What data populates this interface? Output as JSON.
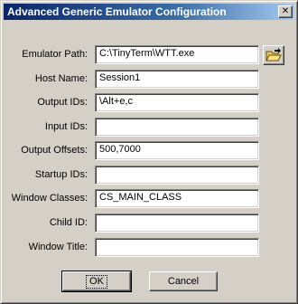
{
  "window": {
    "title": "Advanced Generic Emulator Configuration",
    "close_glyph": "✕"
  },
  "fields": [
    {
      "label": "Emulator Path:",
      "value": "C:\\TinyTerm\\WTT.exe"
    },
    {
      "label": "Host Name:",
      "value": "Session1"
    },
    {
      "label": "Output IDs:",
      "value": "\\Alt+e,c"
    },
    {
      "label": "Input IDs:",
      "value": ""
    },
    {
      "label": "Output Offsets:",
      "value": "500,7000"
    },
    {
      "label": "Startup IDs:",
      "value": ""
    },
    {
      "label": "Window Classes:",
      "value": "CS_MAIN_CLASS"
    },
    {
      "label": "Child ID:",
      "value": ""
    },
    {
      "label": "Window Title:",
      "value": ""
    }
  ],
  "browse_icon": "folder-open-icon",
  "buttons": {
    "ok": "OK",
    "cancel": "Cancel"
  }
}
